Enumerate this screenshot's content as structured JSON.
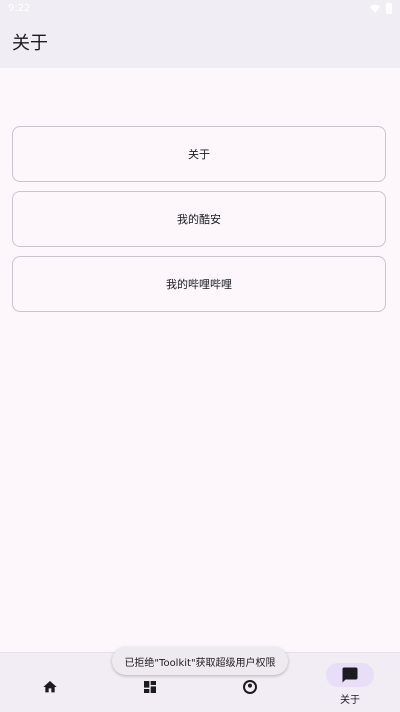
{
  "status_bar": {
    "time": "9:22"
  },
  "app_bar": {
    "title": "关于"
  },
  "cards": [
    {
      "label": "关于"
    },
    {
      "label": "我的酷安"
    },
    {
      "label": "我的哔哩哔哩"
    }
  ],
  "toast": {
    "message": "已拒绝\"Toolkit\"获取超级用户权限"
  },
  "bottom_nav": {
    "items": [
      {
        "icon": "home-icon",
        "label": "",
        "active": false
      },
      {
        "icon": "dashboard-icon",
        "label": "",
        "active": false
      },
      {
        "icon": "account-icon",
        "label": "",
        "active": false
      },
      {
        "icon": "chat-icon",
        "label": "关于",
        "active": true
      }
    ]
  },
  "colors": {
    "background": "#fdf7fc",
    "app_bar": "#f1edf4",
    "card_border": "#cac4cf",
    "nav_active_indicator": "#e8def8",
    "text": "#1c1b1f"
  }
}
